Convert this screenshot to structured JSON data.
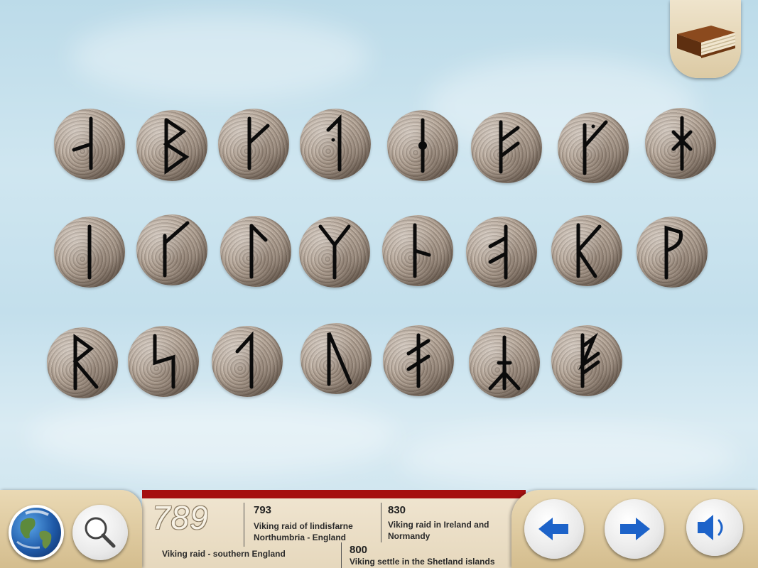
{
  "book_button": {
    "icon": "book-icon"
  },
  "runes": [
    {
      "name": "rune-stone-1",
      "glyph": "rune-1"
    },
    {
      "name": "rune-stone-2",
      "glyph": "rune-b"
    },
    {
      "name": "rune-stone-3",
      "glyph": "rune-k"
    },
    {
      "name": "rune-stone-4",
      "glyph": "rune-hook"
    },
    {
      "name": "rune-stone-5",
      "glyph": "rune-i-dot"
    },
    {
      "name": "rune-stone-6",
      "glyph": "rune-f"
    },
    {
      "name": "rune-stone-7",
      "glyph": "rune-kd"
    },
    {
      "name": "rune-stone-8",
      "glyph": "rune-h-star"
    },
    {
      "name": "rune-stone-9",
      "glyph": "rune-i"
    },
    {
      "name": "rune-stone-10",
      "glyph": "rune-k2"
    },
    {
      "name": "rune-stone-11",
      "glyph": "rune-l"
    },
    {
      "name": "rune-stone-12",
      "glyph": "rune-m"
    },
    {
      "name": "rune-stone-13",
      "glyph": "rune-n"
    },
    {
      "name": "rune-stone-14",
      "glyph": "rune-o"
    },
    {
      "name": "rune-stone-15",
      "glyph": "rune-k3"
    },
    {
      "name": "rune-stone-16",
      "glyph": "rune-p"
    },
    {
      "name": "rune-stone-17",
      "glyph": "rune-r"
    },
    {
      "name": "rune-stone-18",
      "glyph": "rune-s"
    },
    {
      "name": "rune-stone-19",
      "glyph": "rune-t"
    },
    {
      "name": "rune-stone-20",
      "glyph": "rune-u"
    },
    {
      "name": "rune-stone-21",
      "glyph": "rune-ae"
    },
    {
      "name": "rune-stone-22",
      "glyph": "rune-y"
    },
    {
      "name": "rune-stone-23",
      "glyph": "rune-z"
    }
  ],
  "timeline": {
    "current_year": "789",
    "current_event": "Viking raid - southern England",
    "events": [
      {
        "year": "793",
        "text_line1": "Viking raid of lindisfarne",
        "text_line2": "Northumbria - England"
      },
      {
        "year": "830",
        "text_line1": "Viking raid in Ireland and",
        "text_line2": "Normandy"
      },
      {
        "year": "800",
        "text_line1": "Viking settle in the Shetland islands",
        "text_line2": ""
      }
    ]
  },
  "controls": {
    "globe": "globe-icon",
    "search": "magnifier-icon",
    "prev": "arrow-left-icon",
    "next": "arrow-right-icon",
    "audio": "speaker-icon"
  },
  "colors": {
    "timeline_band": "#a51010",
    "arrow_blue": "#1d63c9",
    "parchment": "#e6d8bd"
  }
}
